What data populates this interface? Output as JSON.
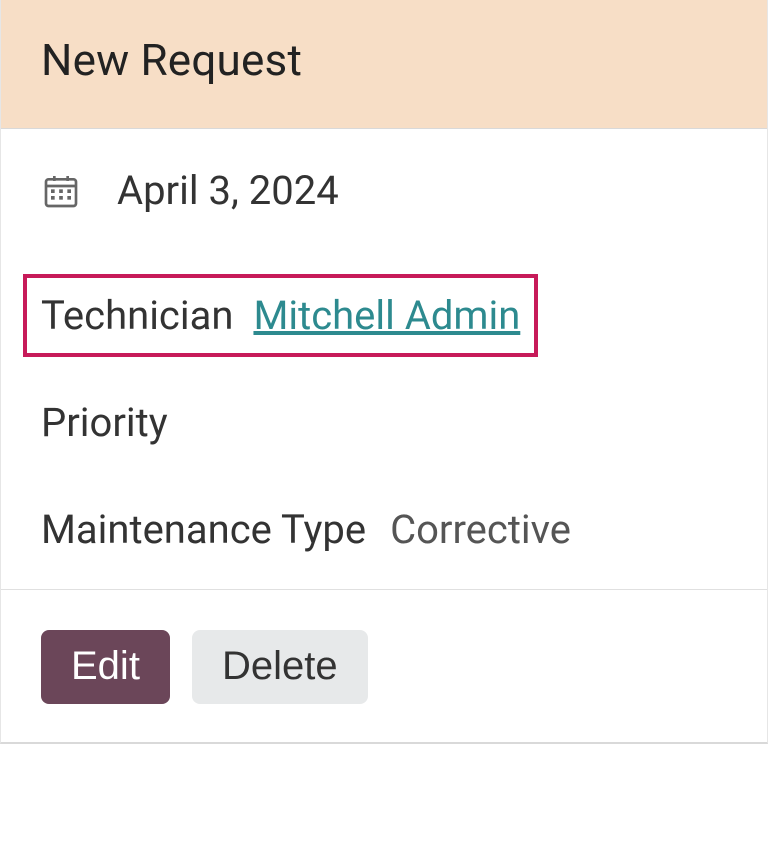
{
  "header": {
    "title": "New Request"
  },
  "fields": {
    "date_value": "April 3, 2024",
    "technician_label": "Technician",
    "technician_value": "Mitchell Admin",
    "priority_label": "Priority",
    "maintenance_type_label": "Maintenance Type",
    "maintenance_type_value": "Corrective"
  },
  "buttons": {
    "edit_label": "Edit",
    "delete_label": "Delete"
  },
  "colors": {
    "header_bg": "#f7dec6",
    "link": "#2d8a8f",
    "highlight_border": "#c71a59",
    "primary_btn": "#6b4659"
  }
}
